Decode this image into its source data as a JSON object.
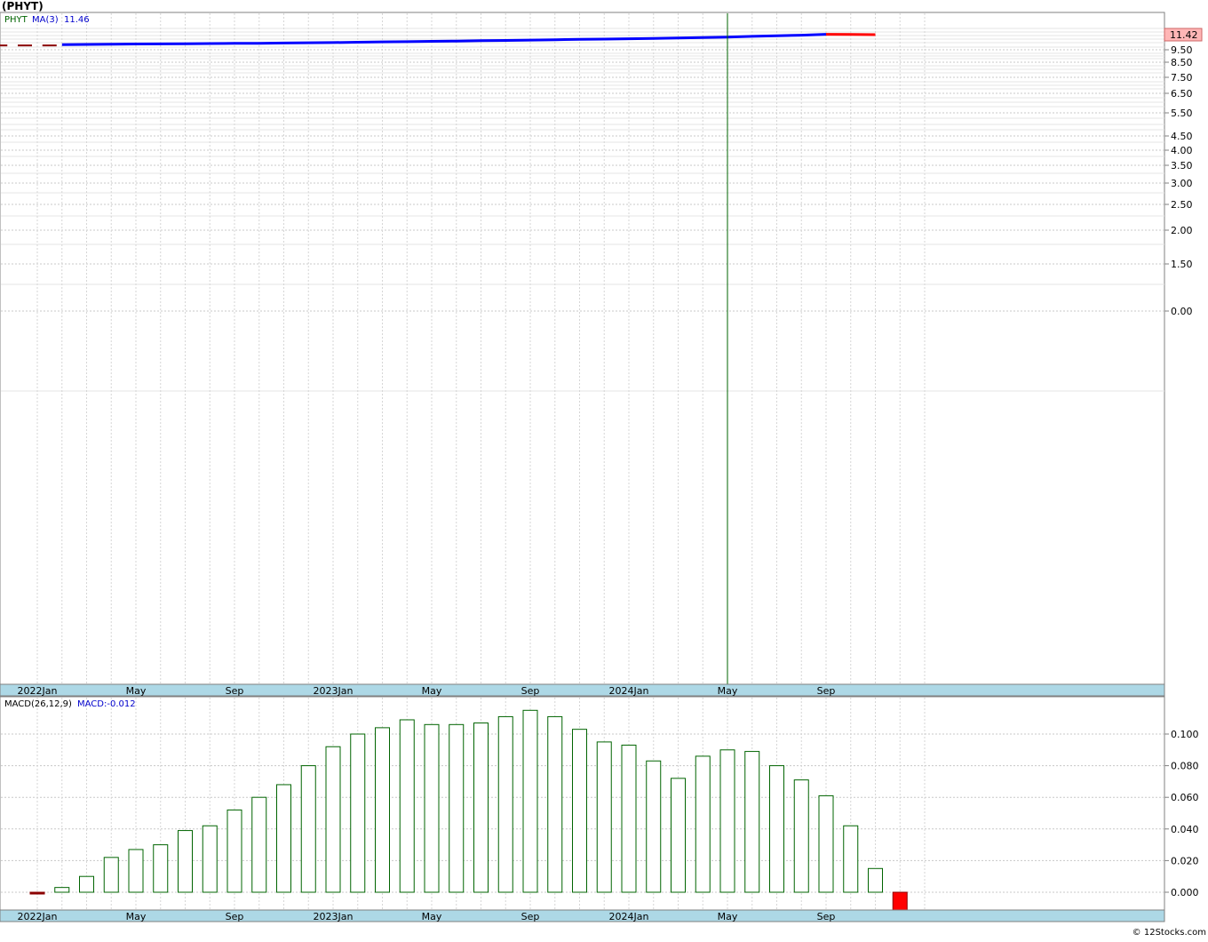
{
  "header": {
    "symbol_title": "(PHYT)"
  },
  "price_panel": {
    "legend": {
      "symbol": "PHYT",
      "ma_label": "MA(3)",
      "ma_value": "11.46"
    },
    "last_price_tag": "11.42",
    "colors": {
      "ma_line": "#0000ff",
      "recent_ma": "#ff0000",
      "symbol_text": "#006400",
      "price_tag_bg": "#ffb6b6",
      "axis_band": "#add8e6"
    }
  },
  "macd_panel": {
    "legend": {
      "label": "MACD(26,12,9)",
      "value_label": "MACD:-0.012"
    },
    "colors": {
      "positive": "#006400",
      "negative_fill": "#ff0000"
    }
  },
  "footer": {
    "copyright": "© 12Stocks.com"
  },
  "chart_data": [
    {
      "type": "line",
      "panel": "price",
      "scale": "log",
      "y_ticks": [
        "9.50",
        "8.50",
        "7.50",
        "6.50",
        "5.50",
        "4.50",
        "4.00",
        "3.50",
        "3.00",
        "2.50",
        "2.00",
        "1.50",
        "0.00"
      ],
      "x_tick_labels": [
        "2022Jan",
        "May",
        "Sep",
        "2023Jan",
        "May",
        "Sep",
        "2024Jan",
        "May",
        "Sep"
      ],
      "series": [
        {
          "name": "MA(3)",
          "x": [
            "2022-02",
            "2022-03",
            "2022-04",
            "2022-05",
            "2022-06",
            "2022-07",
            "2022-08",
            "2022-09",
            "2022-10",
            "2022-11",
            "2022-12",
            "2023-01",
            "2023-02",
            "2023-03",
            "2023-04",
            "2023-05",
            "2023-06",
            "2023-07",
            "2023-08",
            "2023-09",
            "2023-10",
            "2023-11",
            "2023-12",
            "2024-01",
            "2024-02",
            "2024-03",
            "2024-04",
            "2024-05",
            "2024-06",
            "2024-07",
            "2024-08",
            "2024-09",
            "2024-10",
            "2024-11"
          ],
          "values": [
            10.15,
            10.18,
            10.2,
            10.23,
            10.25,
            10.27,
            10.29,
            10.31,
            10.33,
            10.36,
            10.39,
            10.42,
            10.46,
            10.5,
            10.53,
            10.57,
            10.61,
            10.65,
            10.69,
            10.73,
            10.78,
            10.82,
            10.86,
            10.9,
            10.95,
            11.0,
            11.05,
            11.12,
            11.2,
            11.28,
            11.35,
            11.46,
            11.44,
            11.42
          ]
        }
      ],
      "price_bars": [
        {
          "x": "2021-12",
          "value": 10.05
        },
        {
          "x": "2022-01",
          "value": 10.05
        },
        {
          "x": "2022-02",
          "value": 10.05
        }
      ],
      "vertical_marker": {
        "x": "2024-05"
      }
    },
    {
      "type": "bar",
      "panel": "macd",
      "title": "MACD(26,12,9)",
      "y_ticks": [
        "0.100",
        "0.080",
        "0.060",
        "0.040",
        "0.020",
        "0.000"
      ],
      "ylim": [
        -0.012,
        0.117
      ],
      "x_tick_labels": [
        "2022Jan",
        "May",
        "Sep",
        "2023Jan",
        "May",
        "Sep",
        "2024Jan",
        "May",
        "Sep"
      ],
      "categories": [
        "2022-01",
        "2022-02",
        "2022-03",
        "2022-04",
        "2022-05",
        "2022-06",
        "2022-07",
        "2022-08",
        "2022-09",
        "2022-10",
        "2022-11",
        "2022-12",
        "2023-01",
        "2023-02",
        "2023-03",
        "2023-04",
        "2023-05",
        "2023-06",
        "2023-07",
        "2023-08",
        "2023-09",
        "2023-10",
        "2023-11",
        "2023-12",
        "2024-01",
        "2024-02",
        "2024-03",
        "2024-04",
        "2024-05",
        "2024-06",
        "2024-07",
        "2024-08",
        "2024-09",
        "2024-10",
        "2024-11",
        "2024-12",
        "2025-01"
      ],
      "values": [
        -0.001,
        0.003,
        0.01,
        0.022,
        0.027,
        0.03,
        0.039,
        0.042,
        0.052,
        0.06,
        0.068,
        0.08,
        0.092,
        0.1,
        0.104,
        0.109,
        0.106,
        0.106,
        0.107,
        0.111,
        0.115,
        0.111,
        0.103,
        0.095,
        0.093,
        0.083,
        0.072,
        0.086,
        0.09,
        0.089,
        0.08,
        0.071,
        0.061,
        0.042,
        0.015,
        -0.012
      ]
    }
  ]
}
